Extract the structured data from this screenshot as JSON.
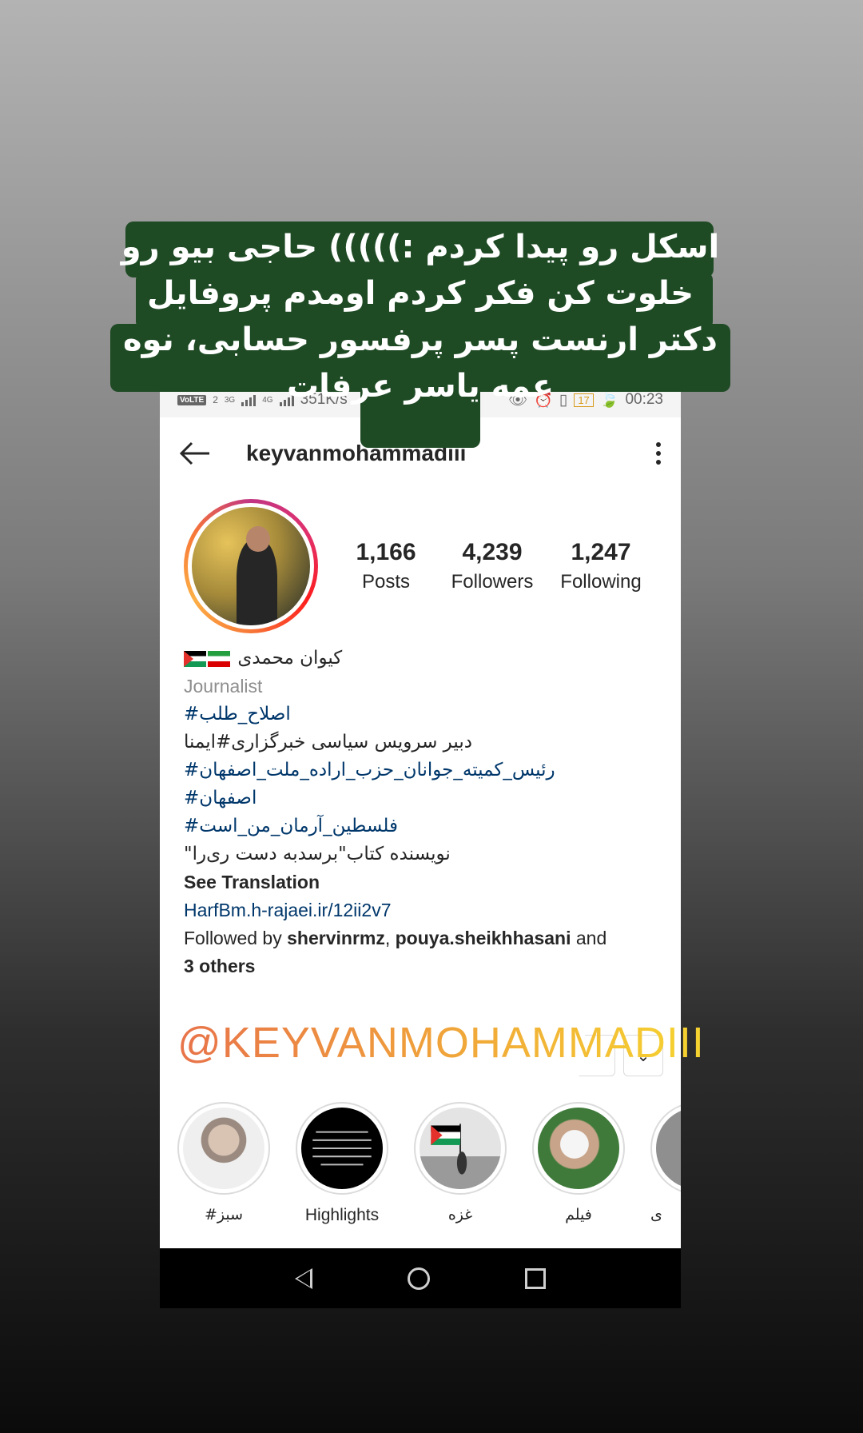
{
  "status_bar": {
    "volte": "VoLTE",
    "sim": "2",
    "net1": "3G",
    "net2": "4G",
    "speed": "351K/s",
    "battery": "17",
    "time": "00:23"
  },
  "profile": {
    "username": "keyvanmohammadiii",
    "stats": [
      {
        "value": "1,166",
        "label": "Posts"
      },
      {
        "value": "4,239",
        "label": "Followers"
      },
      {
        "value": "1,247",
        "label": "Following"
      }
    ],
    "display_name": "کیوان محمدی",
    "category": "Journalist",
    "bio_lines": [
      "#اصلاح_طلب",
      "دبیر سرویس سیاسی خبرگزاری#ایمنا",
      "#رئیس_کمیته_جوانان_حزب_اراده_ملت_اصفهان",
      "#اصفهان",
      "#فلسطین_آرمان_من_است",
      "\"نویسنده کتاب\"برسدبه دست ری‌را"
    ],
    "see_translation": "See Translation",
    "link": "HarfBm.h-rajaei.ir/12ii2v7",
    "followed_by_prefix": "Followed by ",
    "followed_by_user1": "shervinrmz",
    "followed_by_sep": ", ",
    "followed_by_user2": "pouya.sheikhhasani",
    "followed_by_and": " and",
    "followed_by_others": "3 others"
  },
  "watermark": "@KEYVANMOHAMMADIII",
  "highlights": [
    {
      "label": "#سبز",
      "icon": "portrait-thumb"
    },
    {
      "label": "Highlights",
      "icon": "text-thumb"
    },
    {
      "label": "غزه",
      "icon": "flag-thumb"
    },
    {
      "label": "فیلم",
      "icon": "cleric-thumb"
    },
    {
      "label": "ی",
      "icon": "partial-thumb"
    }
  ],
  "caption": "اسکل رو پیدا کردم :))))) حاجی بیو رو خلوت کن فکر کردم اومدم پروفایل دکتر ارنست پسر پرفسور حسابی، نوه عمه یاسر عرفات",
  "colors": {
    "caption_bg": "#1e4a24",
    "link_blue": "#00376b",
    "story_ring_start": "#c13584",
    "story_ring_end": "#fcaf45"
  }
}
